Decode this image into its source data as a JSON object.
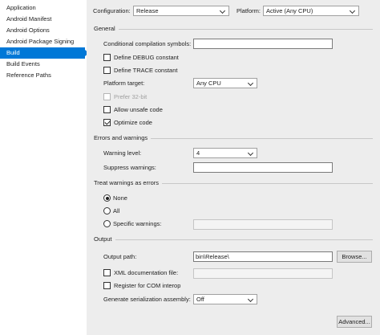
{
  "sidebar": {
    "items": [
      {
        "label": "Application"
      },
      {
        "label": "Android Manifest"
      },
      {
        "label": "Android Options"
      },
      {
        "label": "Android Package Signing"
      },
      {
        "label": "Build"
      },
      {
        "label": "Build Events"
      },
      {
        "label": "Reference Paths"
      }
    ],
    "selected_index": 4
  },
  "header": {
    "configuration_label": "Configuration:",
    "configuration_value": "Release",
    "platform_label": "Platform:",
    "platform_value": "Active (Any CPU)"
  },
  "general": {
    "title": "General",
    "conditional_symbols_label": "Conditional compilation symbols:",
    "conditional_symbols_value": "",
    "define_debug_label": "Define DEBUG constant",
    "define_debug_checked": false,
    "define_trace_label": "Define TRACE constant",
    "define_trace_checked": false,
    "platform_target_label": "Platform target:",
    "platform_target_value": "Any CPU",
    "prefer32_label": "Prefer 32-bit",
    "prefer32_checked": false,
    "allow_unsafe_label": "Allow unsafe code",
    "allow_unsafe_checked": false,
    "optimize_label": "Optimize code",
    "optimize_checked": true
  },
  "errors": {
    "title": "Errors and warnings",
    "warning_level_label": "Warning level:",
    "warning_level_value": "4",
    "suppress_label": "Suppress warnings:",
    "suppress_value": ""
  },
  "treat_warnings": {
    "title": "Treat warnings as errors",
    "none_label": "None",
    "all_label": "All",
    "specific_label": "Specific warnings:",
    "specific_value": "",
    "selected": "None"
  },
  "output": {
    "title": "Output",
    "output_path_label": "Output path:",
    "output_path_value": "bin\\Release\\",
    "browse_label": "Browse...",
    "xml_doc_label": "XML documentation file:",
    "xml_doc_checked": false,
    "xml_doc_value": "",
    "com_interop_label": "Register for COM interop",
    "com_interop_checked": false,
    "serialization_label": "Generate serialization assembly:",
    "serialization_value": "Off",
    "advanced_label": "Advanced..."
  },
  "colors": {
    "accent": "#0078d7",
    "panel_background": "#ededed"
  }
}
